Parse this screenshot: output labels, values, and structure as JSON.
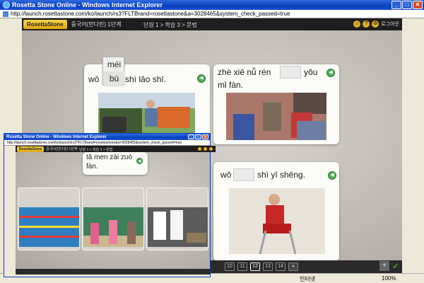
{
  "window": {
    "title": "Rosetta Stone Online - Windows Internet Explorer",
    "url": "http://launch.rosettastone.com/ko/launch/rs3?FLTBrand=rosettastone&a=3028465&system_check_passed=true",
    "minimize": "_",
    "maximize": "□",
    "close": "✕"
  },
  "app": {
    "logo": "RosettaStone",
    "unit_label": "중국어(만다린) 1단계",
    "breadcrumb": "단원 1 > 학습 3 > 문법",
    "icon_help": "?",
    "logout": "로그아웃"
  },
  "cards": [
    {
      "text_before": "wǒ",
      "text_after": "shì lǎo shī."
    },
    {
      "line1_before": "zhè xiē nǚ rén",
      "line1_after": "yǒu",
      "line2": "mǐ fàn."
    },
    {
      "text_before": "wǒ",
      "text_after": "shì yī shēng."
    }
  ],
  "choices": [
    "méi",
    "bú"
  ],
  "pager": {
    "pages": [
      "10",
      "11",
      "12",
      "13",
      "14"
    ],
    "current": "12",
    "next": "»",
    "plus": "+",
    "check": "✓"
  },
  "status": {
    "zone": "인터넷",
    "zoom": "100%"
  },
  "inner_window": {
    "title": "Rosetta Stone Online - Windows Internet Explorer",
    "url": "http://launch.rosettastone.com/ko/launch/rs3?FLTBrand=rosettastone&a=3028465&system_check_passed=true",
    "logo": "RosettaStone",
    "unit_label": "중국어(만다린) 1단계",
    "breadcrumb": "단원 1 > 학습 3 > 문법",
    "prompt_line1": "tā men zài zuò",
    "prompt_line2": "fàn."
  },
  "colors": {
    "titlebar": "#0a3fbd",
    "logo": "#e1a911",
    "speaker": "#4caf50",
    "header": "#1e1e1e"
  }
}
